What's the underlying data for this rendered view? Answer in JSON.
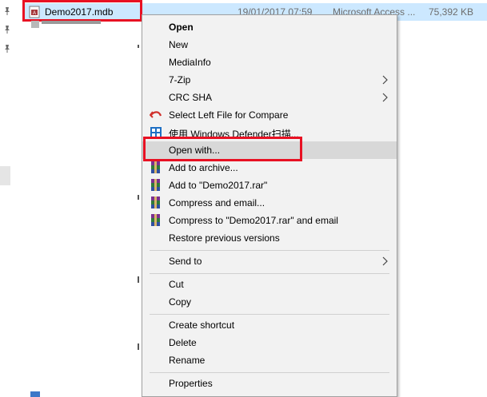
{
  "file_row": {
    "name": "Demo2017.mdb",
    "date": "19/01/2017 07:59",
    "type": "Microsoft Access ...",
    "size": "75,392 KB"
  },
  "context_menu": {
    "items": [
      {
        "label": "Open"
      },
      {
        "label": "New"
      },
      {
        "label": "MediaInfo"
      },
      {
        "label": "7-Zip"
      },
      {
        "label": "CRC SHA"
      },
      {
        "label": "Select Left File for Compare"
      },
      {
        "label": "使用 Windows Defender扫描..."
      },
      {
        "label": "Open with..."
      },
      {
        "label": "Add to archive..."
      },
      {
        "label": "Add to \"Demo2017.rar\""
      },
      {
        "label": "Compress and email..."
      },
      {
        "label": "Compress to \"Demo2017.rar\" and email"
      },
      {
        "label": "Restore previous versions"
      },
      {
        "label": "Send to"
      },
      {
        "label": "Cut"
      },
      {
        "label": "Copy"
      },
      {
        "label": "Create shortcut"
      },
      {
        "label": "Delete"
      },
      {
        "label": "Rename"
      },
      {
        "label": "Properties"
      }
    ]
  },
  "colors": {
    "selection": "#cce8ff",
    "highlight_box": "#e81123",
    "menu_background": "#f2f2f2",
    "menu_hover": "#d8d8d8"
  },
  "icons": {
    "file": "access-file-icon",
    "pin": "pin-icon",
    "compare": "undo-arrow-icon",
    "defender": "windows-defender-icon",
    "archive": "winrar-icon",
    "submenu": "chevron-right-icon"
  }
}
